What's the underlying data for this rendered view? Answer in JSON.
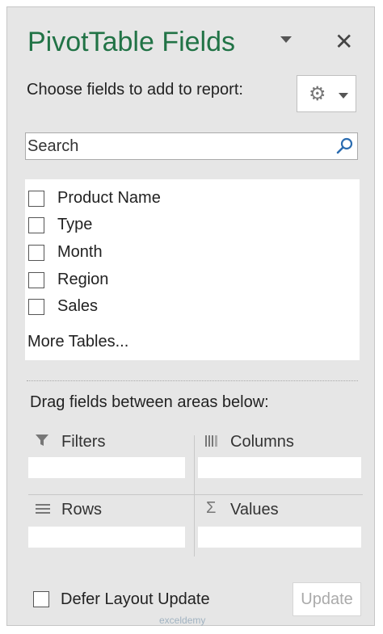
{
  "header": {
    "title": "PivotTable Fields"
  },
  "choose": {
    "label": "Choose fields to add to report:"
  },
  "search": {
    "placeholder": "Search"
  },
  "fields": [
    {
      "label": "Product Name",
      "checked": false
    },
    {
      "label": "Type",
      "checked": false
    },
    {
      "label": "Month",
      "checked": false
    },
    {
      "label": "Region",
      "checked": false
    },
    {
      "label": "Sales",
      "checked": false
    }
  ],
  "more_tables": "More Tables...",
  "drag_label": "Drag fields between areas below:",
  "areas": {
    "filters": "Filters",
    "columns": "Columns",
    "rows": "Rows",
    "values": "Values"
  },
  "footer": {
    "defer_label": "Defer Layout Update",
    "update_label": "Update"
  },
  "watermark": "exceldemy",
  "colors": {
    "title": "#217346",
    "panel": "#e6e6e6"
  }
}
